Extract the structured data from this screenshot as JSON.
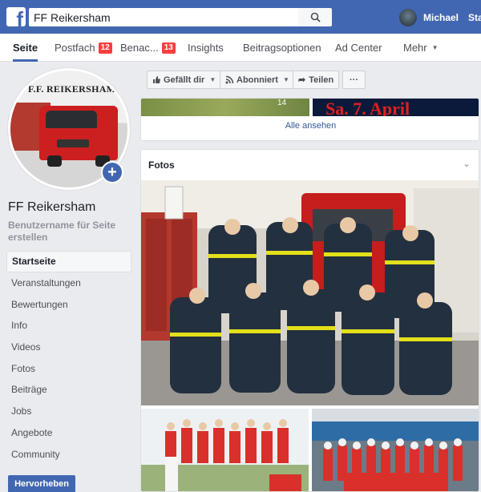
{
  "topbar": {
    "logo_letter": "f",
    "search_value": "FF Reikersham",
    "user_name": "Michael",
    "next_label": "Sta"
  },
  "tabs": [
    {
      "label": "Seite",
      "badge": ""
    },
    {
      "label": "Postfach",
      "badge": "12"
    },
    {
      "label": "Benac...",
      "badge": "13"
    },
    {
      "label": "Insights",
      "badge": ""
    },
    {
      "label": "Beitragsoptionen",
      "badge": ""
    },
    {
      "label": "Ad Center",
      "badge": ""
    },
    {
      "label": "Mehr",
      "badge": ""
    }
  ],
  "sidebar": {
    "profile_sign": "F.F. REIKERSHAM",
    "page_name": "FF Reikersham",
    "username_link": "Benutzername für Seite erstellen",
    "nav": [
      "Startseite",
      "Veranstaltungen",
      "Bewertungen",
      "Info",
      "Videos",
      "Fotos",
      "Beiträge",
      "Jobs",
      "Angebote",
      "Community"
    ],
    "promote_label": "Hervorheben"
  },
  "actions": {
    "like": "Gefällt dir",
    "follow": "Abonniert",
    "share": "Teilen",
    "more": "···"
  },
  "events_card": {
    "left_overlay": "14",
    "right_banner": "Sa. 7. April",
    "see_all": "Alle ansehen"
  },
  "photos_card": {
    "title": "Fotos"
  },
  "colors": {
    "brand": "#4267b2",
    "badge": "#fa3e3e",
    "link": "#365899"
  }
}
